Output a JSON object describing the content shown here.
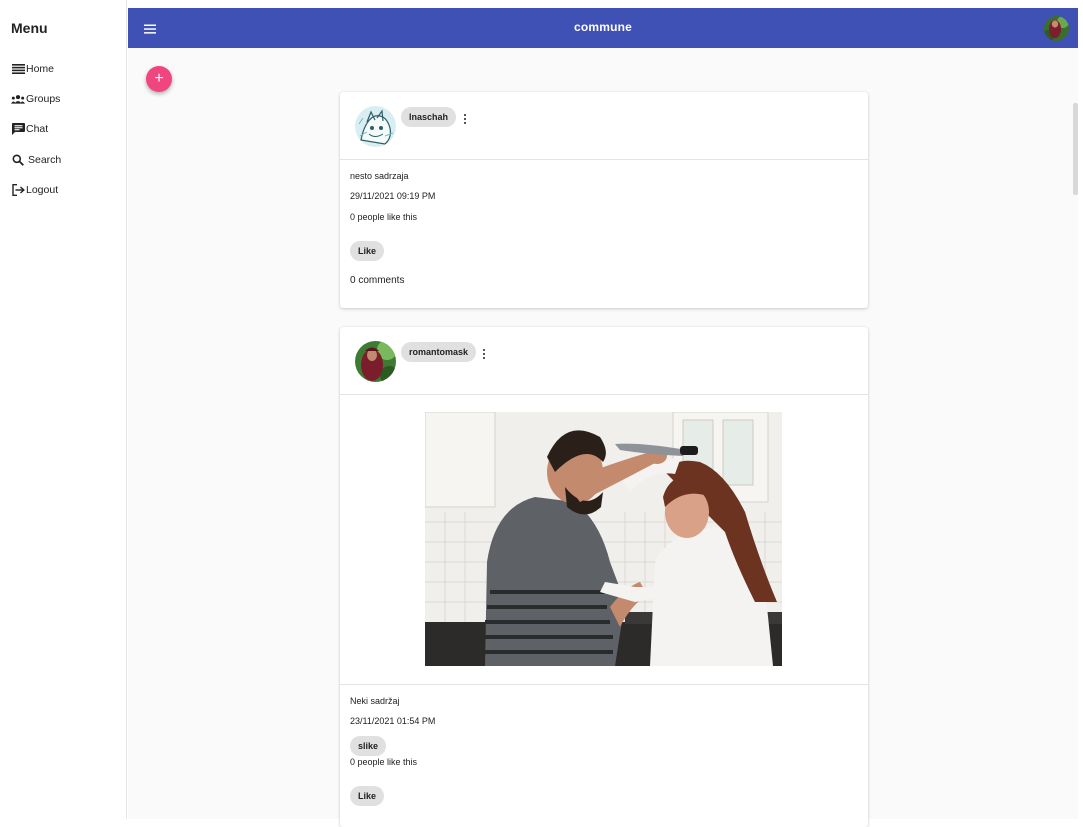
{
  "sidebar": {
    "title": "Menu",
    "items": [
      {
        "label": "Home",
        "icon": "list-icon"
      },
      {
        "label": "Groups",
        "icon": "groups-icon"
      },
      {
        "label": "Chat",
        "icon": "chat-icon"
      },
      {
        "label": "Search",
        "icon": "search-icon"
      },
      {
        "label": "Logout",
        "icon": "logout-icon"
      }
    ]
  },
  "topbar": {
    "title": "commune",
    "color": "#3f51b5"
  },
  "fab": {
    "label": "+",
    "color": "#f0467f"
  },
  "posts": [
    {
      "author": "lnaschah",
      "content": "nesto sadrzaja",
      "timestamp": "29/11/2021 09:19 PM",
      "likes_text": "0 people like this",
      "like_label": "Like",
      "comments_text": "0 comments"
    },
    {
      "author": "romantomask",
      "content": "Neki sadržaj",
      "timestamp": "23/11/2021 01:54 PM",
      "tag": "slike",
      "likes_text": "0 people like this",
      "like_label": "Like"
    }
  ]
}
